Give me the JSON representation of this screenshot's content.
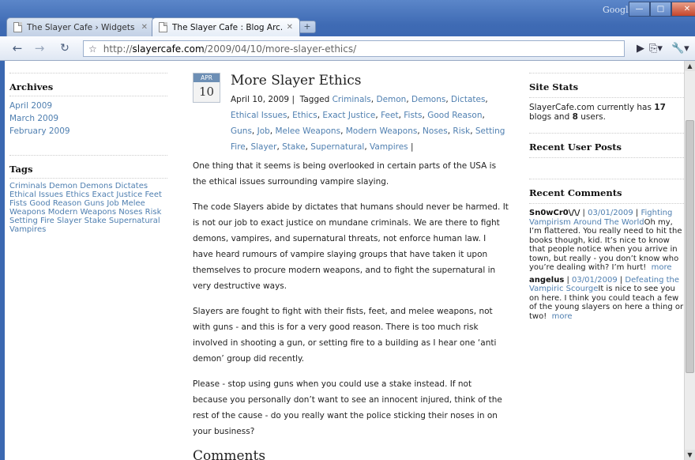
{
  "browser": {
    "tabs": [
      {
        "title": "The Slayer Cafe › Widgets ..."
      },
      {
        "title": "The Slayer Cafe : Blog Arc..."
      }
    ],
    "new_tab_symbol": "+",
    "google_label": "Google",
    "url_prefix": "http://",
    "url_host": "slayercafe.com",
    "url_path": "/2009/04/10/more-slayer-ethics/"
  },
  "left_sidebar": {
    "archives_heading": "Archives",
    "archives": [
      "April 2009",
      "March 2009",
      "February 2009"
    ],
    "tags_heading": "Tags",
    "tags": [
      "Criminals",
      "Demon",
      "Demons",
      "Dictates",
      "Ethical Issues",
      "Ethics",
      "Exact Justice",
      "Feet",
      "Fists",
      "Good Reason",
      "Guns",
      "Job",
      "Melee Weapons",
      "Modern Weapons",
      "Noses",
      "Risk",
      "Setting Fire",
      "Slayer",
      "Stake",
      "Supernatural",
      "Vampires"
    ]
  },
  "post": {
    "cal_month": "APR",
    "cal_day": "10",
    "title": "More Slayer Ethics",
    "date": "April 10, 2009",
    "tagged_label": "Tagged",
    "tags": [
      "Criminals",
      "Demon",
      "Demons",
      "Dictates",
      "Ethical Issues",
      "Ethics",
      "Exact Justice",
      "Feet",
      "Fists",
      "Good Reason",
      "Guns",
      "Job",
      "Melee Weapons",
      "Modern Weapons",
      "Noses",
      "Risk",
      "Setting Fire",
      "Slayer",
      "Stake",
      "Supernatural",
      "Vampires"
    ],
    "paragraphs": [
      "One thing that it seems is being overlooked in certain parts of the USA is the ethical issues surrounding vampire slaying.",
      "The code Slayers abide by dictates that humans should never be harmed. It is not our job to exact justice on mundane criminals. We are there to fight demons, vampires, and supernatural threats, not enforce human law. I have heard rumours of vampire slaying groups that have taken it upon themselves to procure modern weapons, and to fight the supernatural in very destructive ways.",
      "Slayers are fought to fight with their fists, feet, and melee weapons, not with guns - and this is for a very good reason. There is too much risk involved in shooting a gun, or setting fire to a building as I hear one ‘anti demon’ group did recently.",
      "Please - stop using guns when you could use a stake instead. If not because you personally don’t want to see an innocent injured, think of the rest of the cause - do you really want the police sticking their noses in on your business?"
    ],
    "comments_heading": "Comments"
  },
  "right_sidebar": {
    "stats_heading": "Site Stats",
    "stats_prefix": "SlayerCafe.com currently has ",
    "blogs_count": "17",
    "stats_mid": " blogs and ",
    "users_count": "8",
    "stats_suffix": " users.",
    "recent_posts_heading": "Recent User Posts",
    "recent_comments_heading": "Recent Comments",
    "comments": [
      {
        "author": "Sn0wCr0\\/\\/",
        "date": "03/01/2009",
        "post_title": "Fighting Vampirism Around The World",
        "text": "Oh my, I’m flattered. You really need to hit the books though, kid. It’s nice to know that people notice when you arrive in town, but really - you don’t know who you’re dealing with? I’m hurt!",
        "more": "more"
      },
      {
        "author": "angelus",
        "date": "03/01/2009",
        "post_title": "Defeating the Vampiric Scourge",
        "text": "It is nice to see you on here. I think you could teach a few of the young slayers on here a thing or two!",
        "more": "more"
      }
    ]
  },
  "colors": {
    "link": "#4f7fb0",
    "chrome_blue": "#3f6bb4",
    "calendar_header": "#6d8fb5"
  }
}
